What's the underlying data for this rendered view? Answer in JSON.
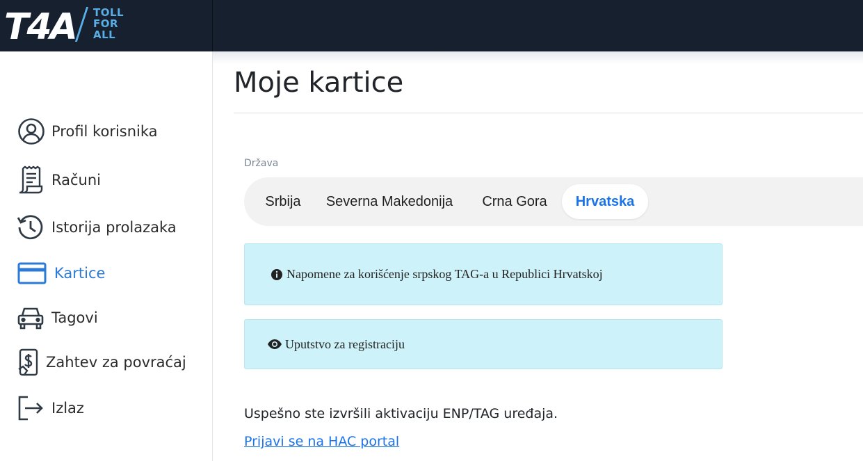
{
  "header": {
    "logo_text": "T4A",
    "tagline": [
      "TOLL",
      "FOR",
      "ALL"
    ],
    "colors": {
      "bar": "#16202e",
      "logo": "#ffffff",
      "tagline": "#5aaee6"
    }
  },
  "sidebar": {
    "items": [
      {
        "label": "Profil korisnika",
        "icon": "user-circle-icon",
        "active": false
      },
      {
        "label": "Računi",
        "icon": "receipt-icon",
        "active": false
      },
      {
        "label": "Istorija prolazaka",
        "icon": "history-icon",
        "active": false
      },
      {
        "label": "Kartice",
        "icon": "credit-card-icon",
        "active": true
      },
      {
        "label": "Tagovi",
        "icon": "car-icon",
        "active": false
      },
      {
        "label": "Zahtev za povraćaj",
        "icon": "refund-icon",
        "active": false
      },
      {
        "label": "Izlaz",
        "icon": "logout-icon",
        "active": false
      }
    ],
    "active_color": "#2b7bd6"
  },
  "main": {
    "title": "Moje kartice",
    "country_label": "Država",
    "tabs": [
      {
        "label": "Srbija",
        "active": false
      },
      {
        "label": "Severna Makedonija",
        "active": false
      },
      {
        "label": "Crna Gora",
        "active": false
      },
      {
        "label": "Hrvatska",
        "active": true
      }
    ],
    "notes": [
      {
        "text": "Napomene za korišćenje srpskog TAG-a u Republici Hrvatskoj",
        "icon": "info-icon"
      },
      {
        "text": "Uputstvo za registraciju",
        "icon": "eye-icon"
      }
    ],
    "success_message": "Uspešno ste izvršili aktivaciju ENP/TAG uređaja.",
    "portal_link": "Prijavi se na HAC portal",
    "colors": {
      "accent": "#1a73e8",
      "note_bg": "#cdf2f9"
    }
  }
}
